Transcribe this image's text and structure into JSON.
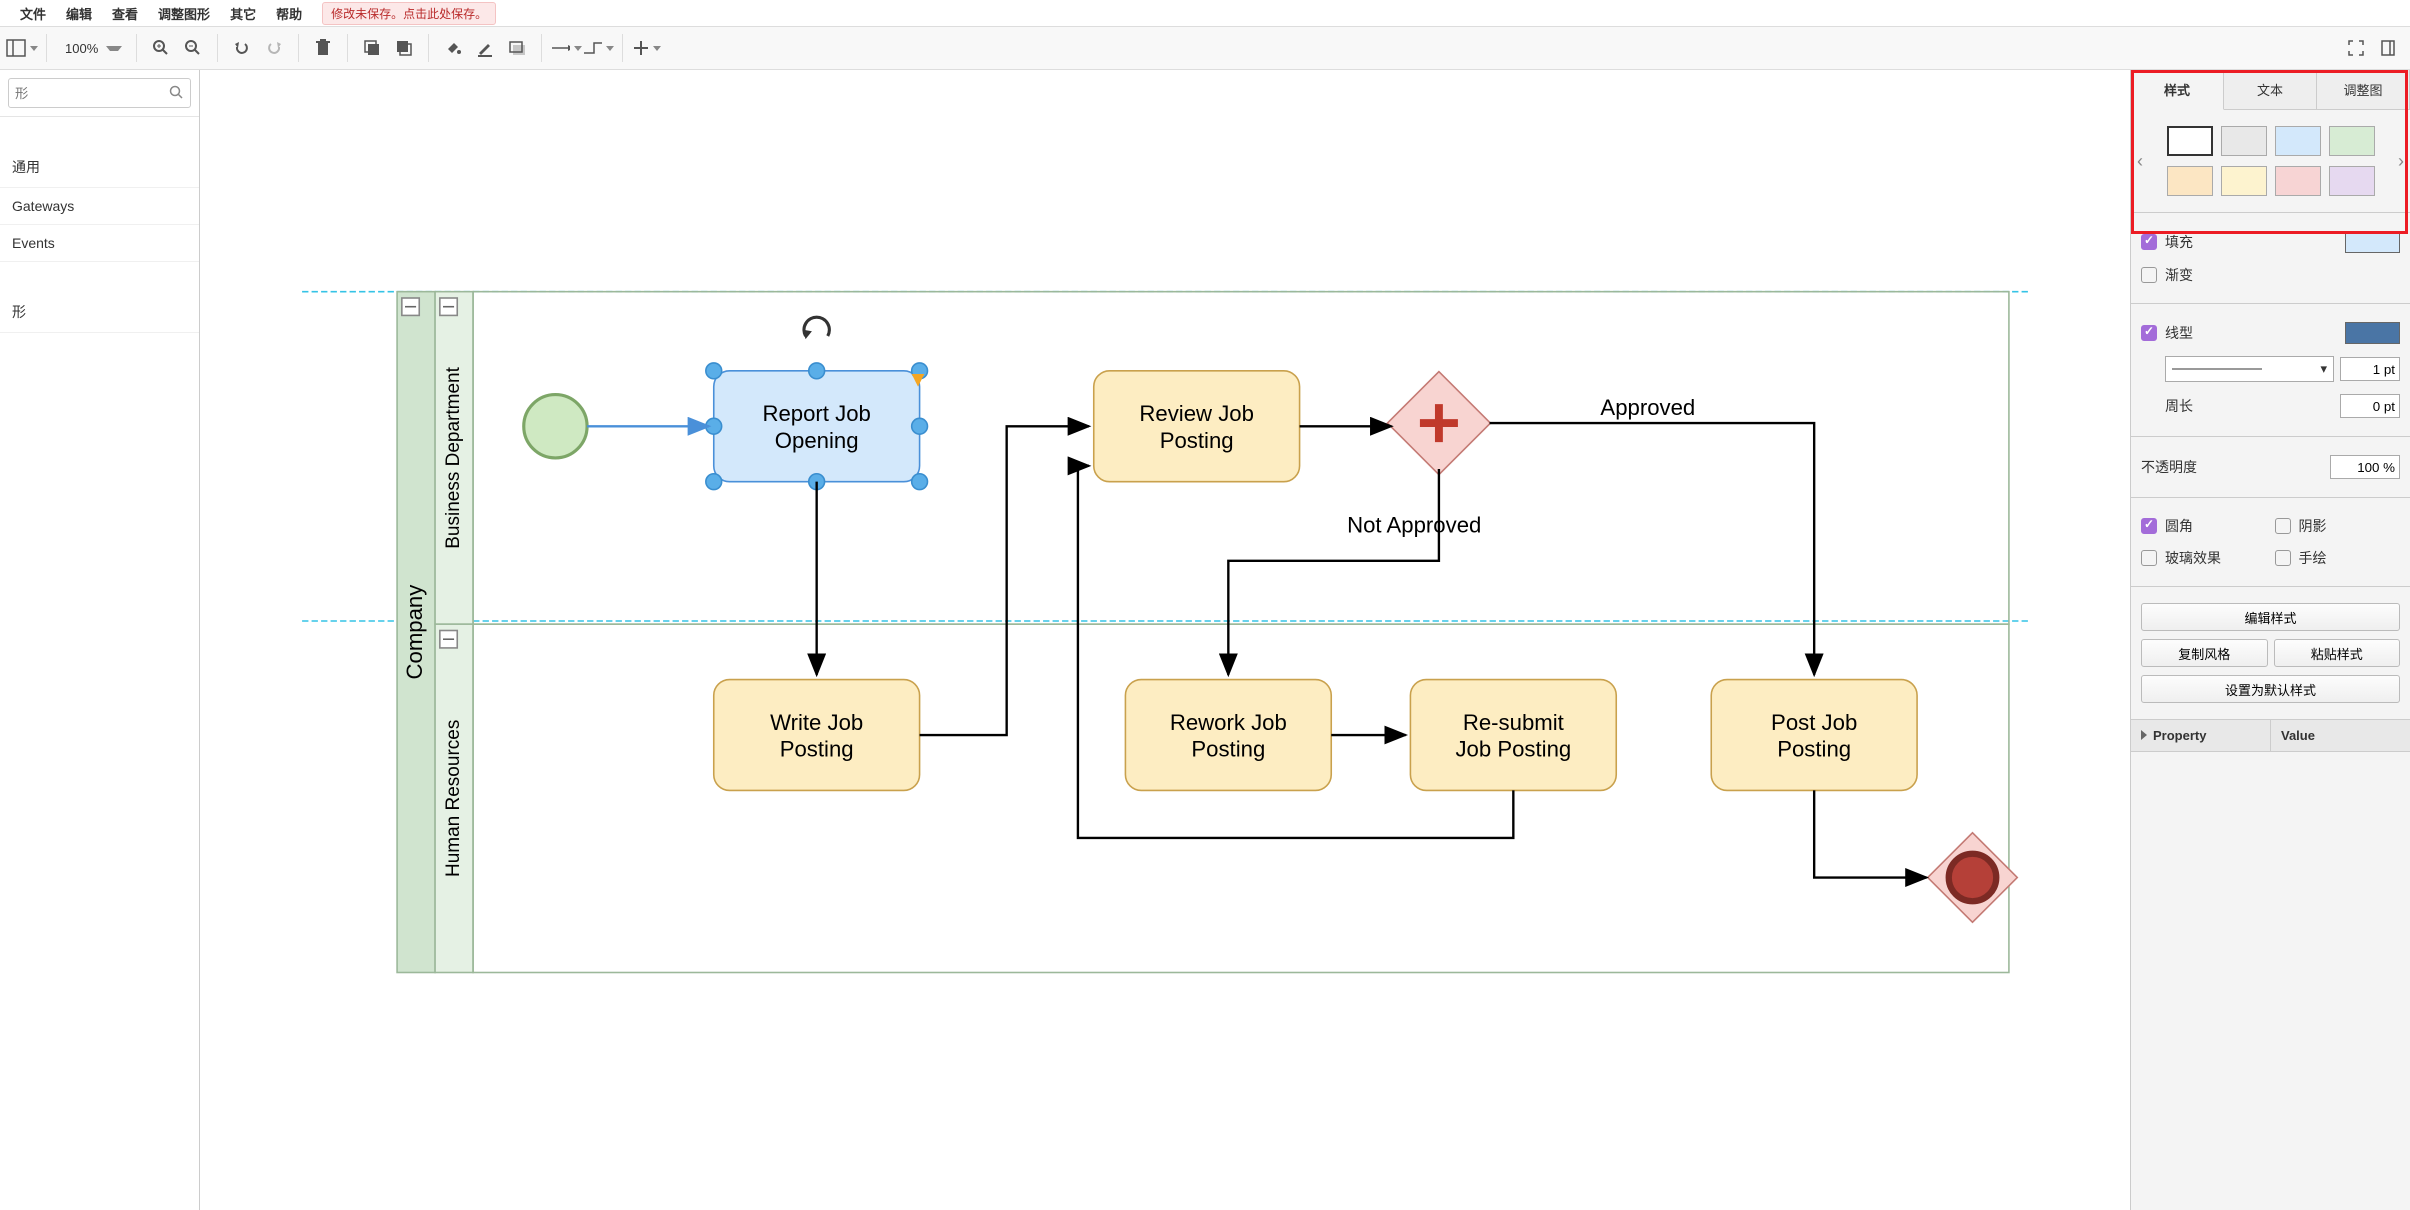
{
  "menu": {
    "file": "文件",
    "edit": "编辑",
    "view": "查看",
    "adjust": "调整图形",
    "other": "其它",
    "help": "帮助",
    "save_warning": "修改未保存。点击此处保存。"
  },
  "toolbar": {
    "zoom": "100%"
  },
  "left": {
    "search_placeholder": "形",
    "cat_general": "通用",
    "cat_gateways": "Gateways",
    "cat_events": "Events",
    "cat_shapes": "形"
  },
  "diagram": {
    "pool": "Company",
    "lane1": "Business Department",
    "lane2": "Human Resources",
    "task_report_l1": "Report Job",
    "task_report_l2": "Opening",
    "task_review_l1": "Review Job",
    "task_review_l2": "Posting",
    "task_write_l1": "Write Job",
    "task_write_l2": "Posting",
    "task_rework_l1": "Rework Job",
    "task_rework_l2": "Posting",
    "task_resubmit_l1": "Re-submit",
    "task_resubmit_l2": "Job Posting",
    "task_post_l1": "Post Job",
    "task_post_l2": "Posting",
    "edge_approved": "Approved",
    "edge_not_approved": "Not Approved"
  },
  "right": {
    "tab_style": "样式",
    "tab_text": "文本",
    "tab_arrange": "调整图",
    "fill": "填充",
    "gradient": "渐变",
    "line": "线型",
    "line_pt": "1 pt",
    "perimeter": "周长",
    "perimeter_pt": "0 pt",
    "opacity": "不透明度",
    "opacity_val": "100 %",
    "rounded": "圆角",
    "shadow": "阴影",
    "glass": "玻璃效果",
    "sketch": "手绘",
    "edit_style": "编辑样式",
    "copy_style": "复制风格",
    "paste_style": "粘贴样式",
    "set_default": "设置为默认样式",
    "property": "Property",
    "value": "Value",
    "fill_color": "#d3e8fb",
    "line_color": "#4a75a5",
    "swatches_row1": [
      "#ffffff",
      "#e8e8e8",
      "#d3e8fb",
      "#d7ecd4"
    ],
    "swatches_row2": [
      "#fce6c3",
      "#fdf3cf",
      "#f7d4d4",
      "#e6d9f0"
    ]
  }
}
